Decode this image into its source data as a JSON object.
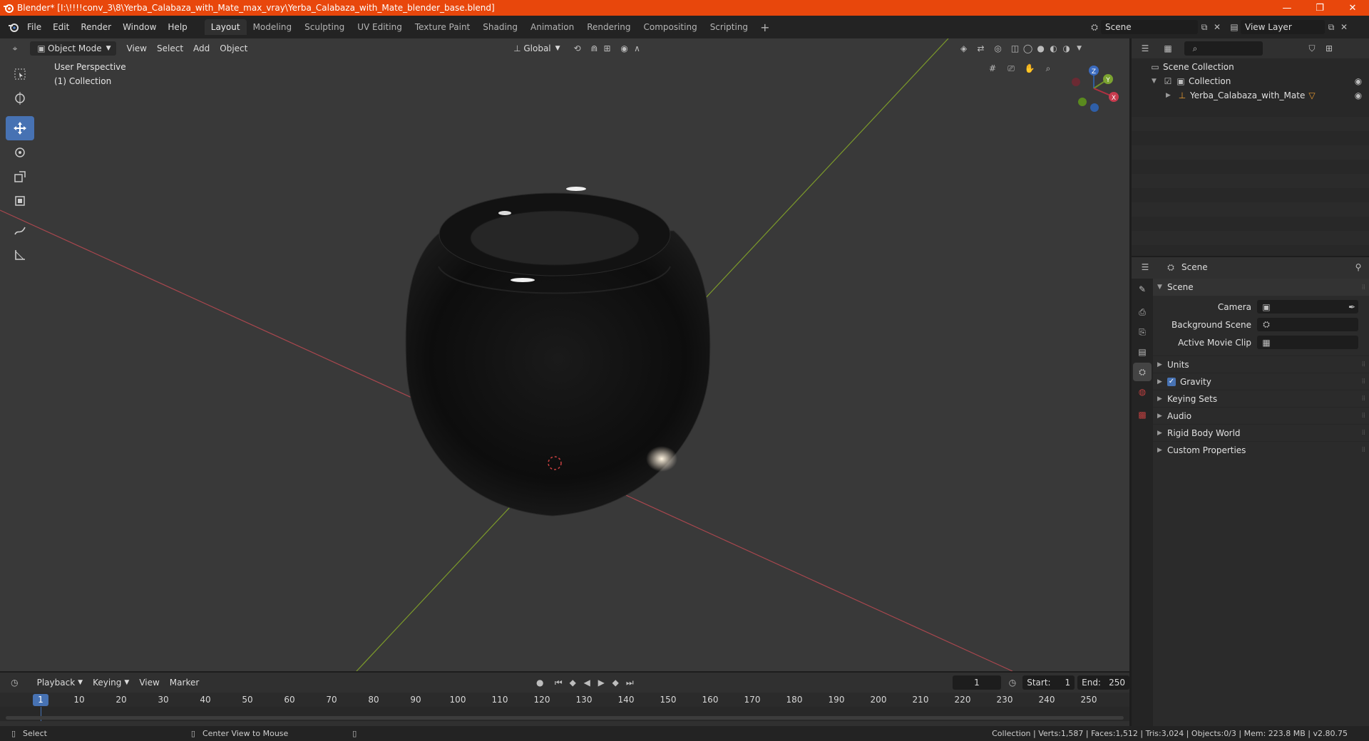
{
  "window": {
    "title": "Blender* [I:\\!!!!conv_3\\8\\Yerba_Calabaza_with_Mate_max_vray\\Yerba_Calabaza_with_Mate_blender_base.blend]",
    "minimize": "—",
    "maximize": "❐",
    "close": "✕"
  },
  "menu": [
    "File",
    "Edit",
    "Render",
    "Window",
    "Help"
  ],
  "workspaces": [
    "Layout",
    "Modeling",
    "Sculpting",
    "UV Editing",
    "Texture Paint",
    "Shading",
    "Animation",
    "Rendering",
    "Compositing",
    "Scripting"
  ],
  "active_workspace": "Layout",
  "scene_selector": "Scene",
  "view_layer_selector": "View Layer",
  "viewport": {
    "mode": "Object Mode",
    "menus": [
      "View",
      "Select",
      "Add",
      "Object"
    ],
    "orientation": "Global",
    "info_line1": "User Perspective",
    "info_line2": "(1) Collection",
    "gizmo": {
      "x": "X",
      "y": "Y",
      "z": "Z"
    }
  },
  "outliner": {
    "root": "Scene Collection",
    "collection": "Collection",
    "object": "Yerba_Calabaza_with_Mate"
  },
  "properties": {
    "context": "Scene",
    "panel": "Scene",
    "camera_label": "Camera",
    "background_scene_label": "Background Scene",
    "active_movie_clip_label": "Active Movie Clip",
    "subpanels": [
      "Units",
      "Gravity",
      "Keying Sets",
      "Audio",
      "Rigid Body World",
      "Custom Properties"
    ],
    "gravity_checked": true
  },
  "timeline": {
    "menus": [
      "Playback",
      "Keying",
      "View",
      "Marker"
    ],
    "current_frame": "1",
    "start_label": "Start:",
    "start": "1",
    "end_label": "End:",
    "end": "250",
    "ticks": [
      "1",
      "10",
      "20",
      "30",
      "40",
      "50",
      "60",
      "70",
      "80",
      "90",
      "100",
      "110",
      "120",
      "130",
      "140",
      "150",
      "160",
      "170",
      "180",
      "190",
      "200",
      "210",
      "220",
      "230",
      "240",
      "250"
    ]
  },
  "status": {
    "select": "Select",
    "center": "Center View to Mouse",
    "stats": "Collection | Verts:1,587 | Faces:1,512 | Tris:3,024 | Objects:0/3 | Mem: 223.8 MB | v2.80.75"
  },
  "colors": {
    "titlebar": "#e8470c",
    "accent": "#4772b3",
    "viewport_bg": "#393939",
    "x_axis": "#a8474e",
    "y_axis": "#7c9a2a"
  }
}
